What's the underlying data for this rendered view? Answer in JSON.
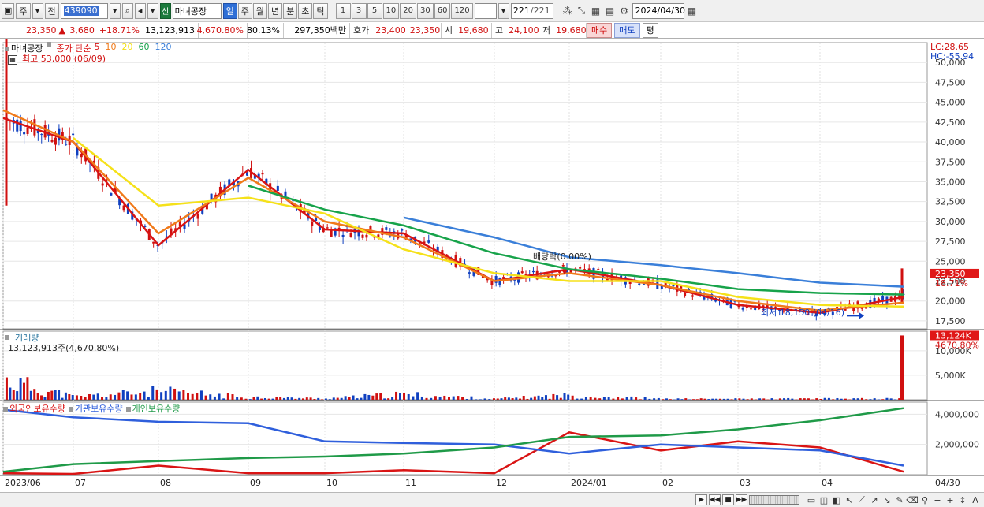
{
  "toolbar": {
    "period_unit": "주",
    "prev_label": "전",
    "stock_code": "439090",
    "sin_badge": "신",
    "stock_name": "마녀공장",
    "intervals": [
      "일",
      "주",
      "월",
      "년",
      "분",
      "초",
      "틱"
    ],
    "active_interval": "일",
    "minute_numbers": [
      "1",
      "3",
      "5",
      "10",
      "20",
      "30",
      "60",
      "120"
    ],
    "count_current": "221",
    "count_total": "/221",
    "date": "2024/04/30"
  },
  "quote": {
    "price": "23,350",
    "arrow": "▲",
    "change": "3,680",
    "change_pct": "+18.71%",
    "volume": "13,123,913",
    "volume_pct": "4,670.80%",
    "turnover_pct": "80.13%",
    "trade_value": "297,350백만",
    "ask_label": "호가",
    "ask": "23,400",
    "bid": "23,350",
    "open_label": "시",
    "open": "19,680",
    "high_label": "고",
    "high": "24,100",
    "low_label": "저",
    "low": "19,680",
    "buy_label": "매수",
    "sell_label": "매도",
    "eval_label": "평"
  },
  "price_pane": {
    "stock_label": "마녀공장",
    "ma_label": "종가 단순",
    "ma_periods": [
      {
        "period": "5",
        "color": "#d91414"
      },
      {
        "period": "10",
        "color": "#f07a1a"
      },
      {
        "period": "20",
        "color": "#f5e11a"
      },
      {
        "period": "60",
        "color": "#17a34a"
      },
      {
        "period": "120",
        "color": "#3a7fd9"
      }
    ],
    "max_label": "최고 53,000 (06/09)",
    "min_label": "최저 18,150 (04/16)",
    "dividend_label": "배당락(0.00%)",
    "lc_label": "LC:28.65",
    "hc_label": "HC:-55.94",
    "last_price_tag": "23,350",
    "last_pct_tag": "18.71%",
    "y_ticks": [
      "50,000",
      "47,500",
      "45,000",
      "42,500",
      "40,000",
      "37,500",
      "35,000",
      "32,500",
      "30,000",
      "27,500",
      "25,000",
      "22,500",
      "20,000",
      "17,500"
    ]
  },
  "volume_pane": {
    "title": "거래량",
    "value_label": "13,123,913주(4,670.80%)",
    "tag_value": "13,124K",
    "tag_pct": "4670.80%",
    "y_ticks": [
      "10,000K",
      "5,000K"
    ]
  },
  "holding_pane": {
    "series": [
      {
        "name": "외국인보유수량",
        "color": "#d91414"
      },
      {
        "name": "기관보유수량",
        "color": "#2f5fdc"
      },
      {
        "name": "개인보유수량",
        "color": "#1f9a48"
      }
    ],
    "y_ticks": [
      "4,000,000",
      "2,000,000"
    ]
  },
  "x_axis": {
    "labels": [
      "2023/06",
      "07",
      "08",
      "09",
      "10",
      "11",
      "12",
      "2024/01",
      "02",
      "03",
      "04"
    ],
    "end_label": "04/30"
  },
  "colors": {
    "up": "#d01010",
    "down": "#1040c0",
    "ma5": "#d91414",
    "ma10": "#f07a1a",
    "ma20": "#f5e11a",
    "ma60": "#17a34a",
    "ma120": "#3a7fd9"
  },
  "chart_data": [
    {
      "type": "line",
      "title": "마녀공장",
      "ylabel": "",
      "ylim": [
        16500,
        52500
      ],
      "x": [
        "2023/06",
        "07",
        "08",
        "09",
        "10",
        "11",
        "12",
        "2024/01",
        "02",
        "03",
        "04",
        "04/30"
      ],
      "series": [
        {
          "name": "5",
          "values": [
            43000,
            40000,
            27000,
            36500,
            29000,
            28500,
            22500,
            24000,
            22000,
            19500,
            18500,
            20500
          ]
        },
        {
          "name": "10",
          "values": [
            44000,
            40000,
            28500,
            35500,
            30000,
            28000,
            22500,
            23500,
            22000,
            20000,
            18800,
            19800
          ]
        },
        {
          "name": "20",
          "values": [
            null,
            40500,
            32000,
            33000,
            31000,
            26500,
            23500,
            22500,
            22500,
            20500,
            19500,
            19300
          ]
        },
        {
          "name": "60",
          "values": [
            null,
            null,
            null,
            34500,
            31500,
            29500,
            26000,
            24000,
            22800,
            21500,
            21000,
            20800
          ]
        },
        {
          "name": "120",
          "values": [
            null,
            null,
            null,
            null,
            null,
            30500,
            28000,
            25500,
            24500,
            23500,
            22300,
            21800
          ]
        }
      ],
      "max": {
        "value": 53000,
        "date": "06/09"
      },
      "min": {
        "value": 18150,
        "date": "04/16"
      },
      "last": 23350
    },
    {
      "type": "bar",
      "title": "거래량",
      "ylabel": "",
      "ylim": [
        0,
        14000000
      ],
      "categories": [
        "2023/06",
        "07",
        "08",
        "09",
        "10",
        "11",
        "12",
        "2024/01",
        "02",
        "03",
        "04",
        "04/30"
      ],
      "values": [
        6500000,
        1000000,
        2800000,
        900000,
        400000,
        1800000,
        300000,
        1500000,
        300000,
        300000,
        350000,
        13123913
      ]
    },
    {
      "type": "line",
      "title": "",
      "ylabel": "",
      "ylim": [
        0,
        4800000
      ],
      "x": [
        "2023/06",
        "07",
        "08",
        "09",
        "10",
        "11",
        "12",
        "2024/01",
        "02",
        "03",
        "04",
        "04/30"
      ],
      "series": [
        {
          "name": "외국인보유수량",
          "values": [
            100000,
            50000,
            600000,
            100000,
            100000,
            300000,
            100000,
            2800000,
            1600000,
            2200000,
            1800000,
            200000
          ]
        },
        {
          "name": "기관보유수량",
          "values": [
            4300000,
            3800000,
            3500000,
            3400000,
            2200000,
            2100000,
            2000000,
            1400000,
            2000000,
            1800000,
            1600000,
            600000
          ]
        },
        {
          "name": "개인보유수량",
          "values": [
            200000,
            700000,
            900000,
            1100000,
            1200000,
            1400000,
            1800000,
            2500000,
            2600000,
            3000000,
            3600000,
            4400000
          ]
        }
      ]
    }
  ]
}
